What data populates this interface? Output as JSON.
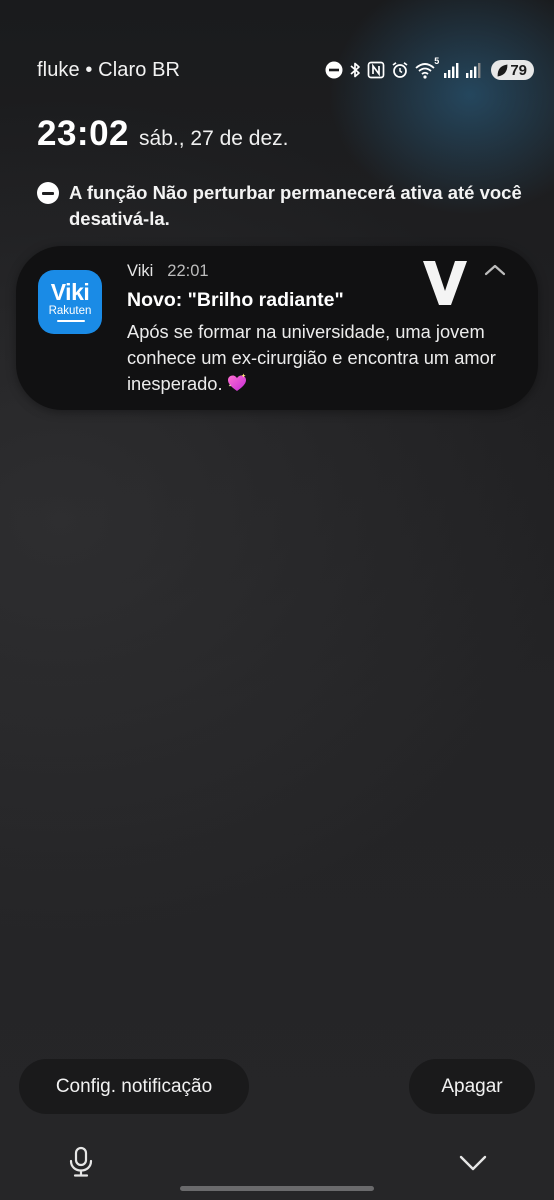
{
  "status_bar": {
    "carrier": "fluke • Claro BR",
    "battery_level": "79",
    "icons": [
      "dnd-icon",
      "bluetooth-icon",
      "nfc-icon",
      "alarm-icon",
      "wifi-icon",
      "signal-icon",
      "signal-icon",
      "battery-icon"
    ],
    "wifi_badge": "5"
  },
  "lock_clock": {
    "time": "23:02",
    "date": "sáb., 27 de dez."
  },
  "dnd_notice": {
    "text": "A função Não perturbar permanecerá ativa até você desativá-la."
  },
  "notification": {
    "app_icon_brand": "Viki",
    "app_icon_sub": "Rakuten",
    "app_name": "Viki",
    "time": "22:01",
    "title": "Novo: \"Brilho radiante\"",
    "body": "Após se formar na universidade, uma jovem conhece um ex-cirurgião e encontra um amor inesperado.",
    "emoji": "sparkling-heart-icon",
    "accent_color": "#1a8be6"
  },
  "actions": {
    "settings_label": "Config. notificação",
    "clear_label": "Apagar"
  },
  "nav": {
    "left_icon": "microphone-icon",
    "right_icon": "chevron-down-icon"
  }
}
